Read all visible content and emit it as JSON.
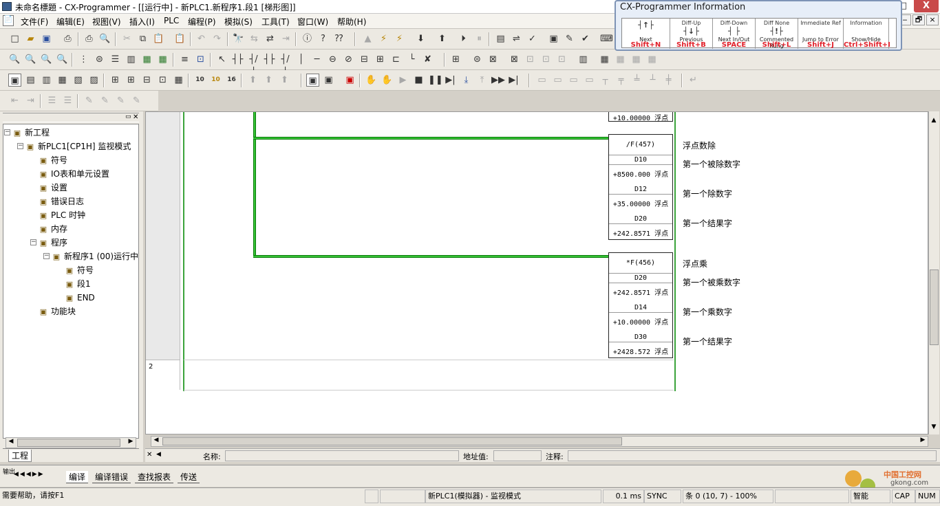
{
  "titlebar": {
    "title": "未命名標題 - CX-Programmer - [[运行中] - 新PLC1.新程序1.段1 [梯形图]]",
    "minimize": "—",
    "maximize": "□",
    "close": "X"
  },
  "menubar": {
    "items": [
      "文件(F)",
      "编辑(E)",
      "视图(V)",
      "插入(I)",
      "PLC",
      "编程(P)",
      "模拟(S)",
      "工具(T)",
      "窗口(W)",
      "帮助(H)"
    ],
    "mdi": [
      "‒",
      "🗗",
      "×"
    ]
  },
  "infopop": {
    "title": "CX-Programmer Information",
    "cells": [
      {
        "sym": "┤↑├",
        "k1": "",
        "k2": "Next",
        "k3": "Shift+N"
      },
      {
        "sym": "┤↓├",
        "k1": "Diff-Up",
        "k2": "Previous",
        "k3": "Shift+B"
      },
      {
        "sym": "┤ ├",
        "k1": "Diff-Down",
        "k2": "Next In/Out",
        "k3": "SPACE"
      },
      {
        "sym": "┤!├",
        "k1": "Diff None",
        "k2": "Commented Rung",
        "k3": "Shift+L"
      },
      {
        "sym": "",
        "k1": "Immediate Ref",
        "k2": "Jump to Error",
        "k3": "Shift+J"
      },
      {
        "sym": "",
        "k1": "Information",
        "k2": "Show/Hide",
        "k3": "Ctrl+Shift+I"
      }
    ]
  },
  "tree": {
    "items": [
      {
        "label": "新工程",
        "icon": "project-icon",
        "depth": 0
      },
      {
        "label": "新PLC1[CP1H] 监视模式",
        "icon": "plc-icon",
        "depth": 1
      },
      {
        "label": "符号",
        "icon": "symbols-icon",
        "depth": 2
      },
      {
        "label": "IO表和单元设置",
        "icon": "io-table-icon",
        "depth": 2
      },
      {
        "label": "设置",
        "icon": "settings-icon",
        "depth": 2
      },
      {
        "label": "错误日志",
        "icon": "error-log-icon",
        "depth": 2
      },
      {
        "label": "PLC 时钟",
        "icon": "clock-icon",
        "depth": 2
      },
      {
        "label": "内存",
        "icon": "memory-icon",
        "depth": 2
      },
      {
        "label": "程序",
        "icon": "programs-icon",
        "depth": 2
      },
      {
        "label": "新程序1 (00)运行中",
        "icon": "program-icon",
        "depth": 3
      },
      {
        "label": "符号",
        "icon": "symbols-icon",
        "depth": 4
      },
      {
        "label": "段1",
        "icon": "section-icon",
        "depth": 4
      },
      {
        "label": "END",
        "icon": "section-icon",
        "depth": 4
      },
      {
        "label": "功能块",
        "icon": "function-block-icon",
        "depth": 2
      }
    ],
    "tab": "工程"
  },
  "ladder": {
    "top_value": "+10.00000 浮点",
    "rung2": "2",
    "blocks": [
      {
        "op": "/F(457)",
        "rows": [
          {
            "label": "D10",
            "value": "+8500.000 浮点",
            "comment": "第一个被除数字"
          },
          {
            "label": "D12",
            "value": "+35.00000 浮点",
            "comment": "第一个除数字"
          },
          {
            "label": "D20",
            "value": "+242.8571 浮点",
            "comment": "第一个结果字"
          }
        ],
        "title": "浮点数除"
      },
      {
        "op": "*F(456)",
        "rows": [
          {
            "label": "D20",
            "value": "+242.8571 浮点",
            "comment": "第一个被乘数字"
          },
          {
            "label": "D14",
            "value": "+10.00000 浮点",
            "comment": "第一个乘数字"
          },
          {
            "label": "D30",
            "value": "+2428.572 浮点",
            "comment": "第一个结果字"
          }
        ],
        "title": "浮点乘"
      }
    ]
  },
  "namebar": {
    "name_label": "名称:",
    "addr_label": "地址值:",
    "comment_label": "注释:"
  },
  "output": {
    "tabs": [
      "编译",
      "编译错误",
      "查找报表",
      "传送"
    ],
    "title": "输出"
  },
  "status": {
    "help": "需要帮助，请按F1",
    "plc": "新PLC1(模拟器) - 监视模式",
    "cycle": "0.1 ms",
    "sync": "SYNC",
    "pos": "条 0 (10, 7)  - 100%",
    "smart": "智能",
    "cap": "CAP",
    "num": "NUM"
  },
  "watermark": {
    "text": "中国工控网",
    "sub": "gkong.com"
  }
}
